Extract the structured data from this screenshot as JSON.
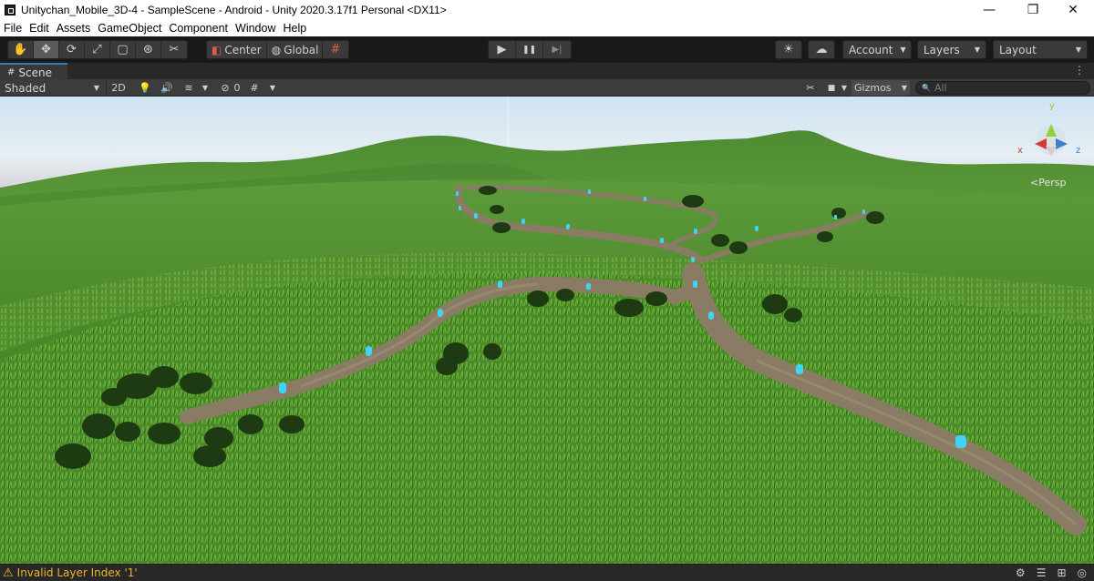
{
  "window": {
    "title": "Unitychan_Mobile_3D-4 - SampleScene - Android - Unity 2020.3.17f1 Personal <DX11>",
    "controls": {
      "minimize": "—",
      "maximize": "❐",
      "close": "✕"
    }
  },
  "menu": [
    "File",
    "Edit",
    "Assets",
    "GameObject",
    "Component",
    "Window",
    "Help"
  ],
  "toolbar": {
    "tools": [
      {
        "name": "hand-tool",
        "glyph": "✋"
      },
      {
        "name": "move-tool",
        "glyph": "✥"
      },
      {
        "name": "rotate-tool",
        "glyph": "⟳"
      },
      {
        "name": "scale-tool",
        "glyph": "⤢"
      },
      {
        "name": "rect-tool",
        "glyph": "▢"
      },
      {
        "name": "transform-tool",
        "glyph": "⊛"
      },
      {
        "name": "custom-tool",
        "glyph": "✂"
      }
    ],
    "pivot_label": "Center",
    "space_label": "Global",
    "snap_glyph": "#",
    "play_glyph": "▶",
    "pause_glyph": "❚❚",
    "step_glyph": "▶|",
    "collab_glyph": "☀",
    "cloud_glyph": "☁",
    "account_label": "Account",
    "layers_label": "Layers",
    "layout_label": "Layout"
  },
  "scene_tab": {
    "icon": "#",
    "label": "Scene",
    "menu_glyph": "⋮"
  },
  "scene_toolbar": {
    "draw_mode": "Shaded",
    "mode_2d": "2D",
    "light_glyph": "💡",
    "audio_glyph": "🔊",
    "fx_glyph": "≋",
    "hidden_glyph": "⊘",
    "hidden_count": "0",
    "grid_glyph": "#",
    "tools_glyph": "✂",
    "camera_glyph": "■",
    "gizmos_label": "Gizmos",
    "search_placeholder": "All",
    "search_glyph": "🔍"
  },
  "viewport": {
    "projection_label": "Persp",
    "gizmo_axes": {
      "y": "y",
      "x": "x",
      "z": "z"
    }
  },
  "status": {
    "message": "Invalid Layer Index '1'",
    "warn_glyph": "⚠",
    "icons": [
      "⚙",
      "☰",
      "⊞",
      "◎"
    ]
  },
  "colors": {
    "editor_bg": "#191919",
    "sky_top": "#c9dff0",
    "grass": "#4f8a2b",
    "path": "#8a7a63",
    "marker": "#3fd0f0",
    "warning": "#f0b429",
    "gizmo_y": "#8ed13a",
    "gizmo_x": "#d13a3a",
    "gizmo_z": "#3a7fd1"
  }
}
